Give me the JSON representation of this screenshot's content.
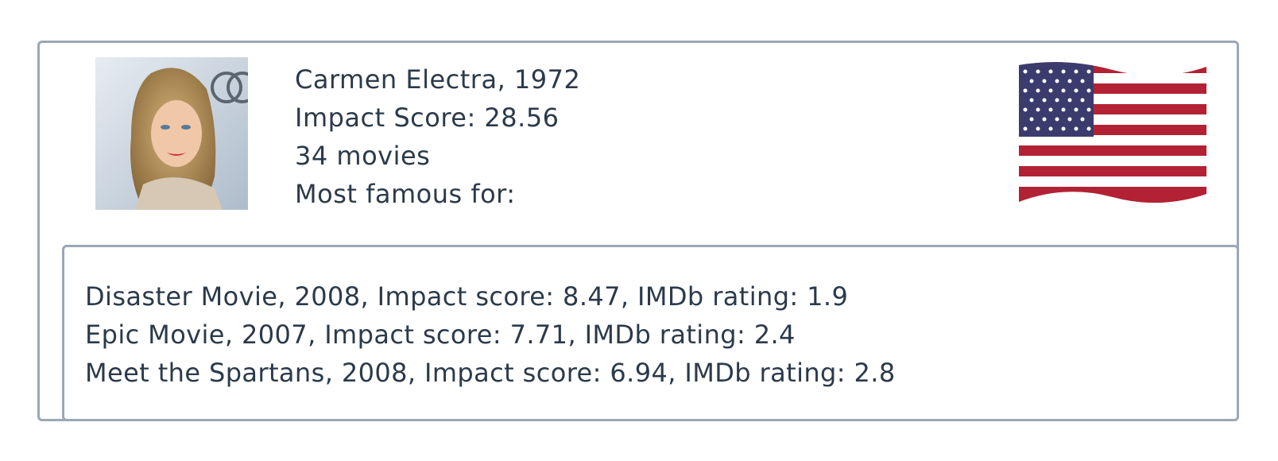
{
  "actor": {
    "name_year": "Carmen Electra, 1972",
    "impact": "Impact Score: 28.56",
    "movie_count": "34 movies",
    "famous_label": "Most famous for:",
    "portrait_icon": "actor-portrait",
    "flag_icon": "us-flag-icon"
  },
  "movies": [
    {
      "text": "Disaster Movie, 2008, Impact score: 8.47, IMDb rating: 1.9"
    },
    {
      "text": "Epic Movie, 2007, Impact score: 7.71, IMDb rating: 2.4"
    },
    {
      "text": "Meet the Spartans, 2008, Impact score: 6.94, IMDb rating: 2.8"
    }
  ],
  "colors": {
    "border": "#9aa8b5",
    "text": "#2b3a4a",
    "flag_red": "#b22234",
    "flag_blue": "#3c3b6e"
  }
}
